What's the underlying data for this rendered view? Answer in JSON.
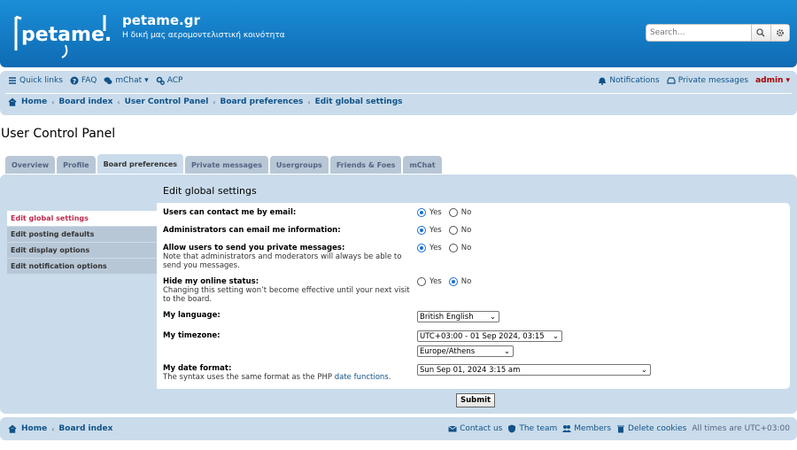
{
  "header": {
    "logo_text": "petame.gr",
    "site_title": "petame.gr",
    "site_desc": "Η δική μας αερομοντελιστική κοινότητα",
    "search_placeholder": "Search..."
  },
  "nav": {
    "quick_links": "Quick links",
    "faq": "FAQ",
    "mchat": "mChat",
    "acp": "ACP",
    "notifications": "Notifications",
    "private_messages": "Private messages",
    "user": "admin"
  },
  "breadcrumbs": [
    "Home",
    "Board index",
    "User Control Panel",
    "Board preferences",
    "Edit global settings"
  ],
  "page_title": "User Control Panel",
  "tabs": [
    "Overview",
    "Profile",
    "Board preferences",
    "Private messages",
    "Usergroups",
    "Friends & Foes",
    "mChat"
  ],
  "active_tab": "Board preferences",
  "sidebar": [
    "Edit global settings",
    "Edit posting defaults",
    "Edit display options",
    "Edit notification options"
  ],
  "content_heading": "Edit global settings",
  "settings": {
    "email": {
      "label": "Users can contact me by email:",
      "yes": "Yes",
      "no": "No",
      "value": "yes"
    },
    "admin_email": {
      "label": "Administrators can email me information:",
      "yes": "Yes",
      "no": "No",
      "value": "yes"
    },
    "pm": {
      "label": "Allow users to send you private messages:",
      "explain": "Note that administrators and moderators will always be able to send you messages.",
      "yes": "Yes",
      "no": "No",
      "value": "yes"
    },
    "online": {
      "label": "Hide my online status:",
      "explain": "Changing this setting won’t become effective until your next visit to the board.",
      "yes": "Yes",
      "no": "No",
      "value": "no"
    },
    "language": {
      "label": "My language:",
      "value": "British English"
    },
    "timezone": {
      "label": "My timezone:",
      "value": "UTC+03:00 - 01 Sep 2024, 03:15",
      "city": "Europe/Athens"
    },
    "date_format": {
      "label": "My date format:",
      "explain": "The syntax uses the same format as the PHP",
      "link": "date functions",
      "after": ".",
      "value": "Sun Sep 01, 2024 3:15 am"
    }
  },
  "submit_label": "Submit",
  "footer": {
    "home": "Home",
    "board_index": "Board index",
    "contact": "Contact us",
    "team": "The team",
    "members": "Members",
    "delete_cookies": "Delete cookies",
    "timezone_note": "All times are UTC+03:00"
  },
  "colors": {
    "header": "#0f6bb3",
    "navbar": "#cadceb",
    "active_side": "#bc2a4d",
    "link": "#105289"
  }
}
